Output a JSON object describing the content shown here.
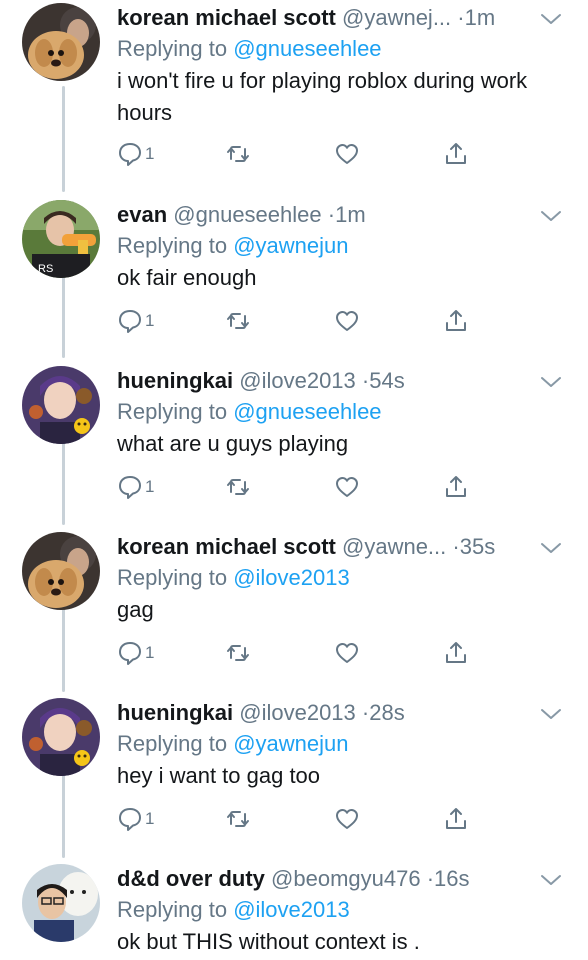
{
  "tweets": [
    {
      "name": "korean michael scott",
      "handle": "@yawnej...",
      "time": "1m",
      "replying_label": "Replying to",
      "replying_to": "@gnueseehlee",
      "text": "i won't fire u for playing roblox during work hours",
      "reply_count": "1",
      "avatar": "dog-and-person-avatar"
    },
    {
      "name": "evan",
      "handle": "@gnueseehlee",
      "time": "1m",
      "replying_label": "Replying to",
      "replying_to": "@yawnejun",
      "text": "ok fair enough",
      "reply_count": "1",
      "avatar": "person-with-toy-gun-avatar"
    },
    {
      "name": "hueningkai",
      "handle": "@ilove2013",
      "time": "54s",
      "replying_label": "Replying to",
      "replying_to": "@gnueseehlee",
      "text": "what are u guys playing",
      "reply_count": "1",
      "avatar": "person-with-emoji-avatar"
    },
    {
      "name": "korean michael scott",
      "handle": "@yawne...",
      "time": "35s",
      "replying_label": "Replying to",
      "replying_to": "@ilove2013",
      "text": "gag",
      "reply_count": "1",
      "avatar": "dog-and-person-avatar"
    },
    {
      "name": "hueningkai",
      "handle": "@ilove2013",
      "time": "28s",
      "replying_label": "Replying to",
      "replying_to": "@yawnejun",
      "text": "hey i want to gag too",
      "reply_count": "1",
      "avatar": "person-with-emoji-avatar"
    },
    {
      "name": "d&d over duty",
      "handle": "@beomgyu476",
      "time": "16s",
      "replying_label": "Replying to",
      "replying_to": "@ilove2013",
      "text": "ok but THIS without context is .",
      "reply_count": "",
      "avatar": "person-with-plush-avatar"
    }
  ],
  "colors": {
    "link": "#1da1f2",
    "secondary_text": "#657786",
    "thread_line": "#c8d1d8"
  },
  "icons": {
    "reply": "speech-bubble-icon",
    "retweet": "retweet-icon",
    "like": "heart-icon",
    "share": "share-icon",
    "more": "chevron-down-icon"
  }
}
